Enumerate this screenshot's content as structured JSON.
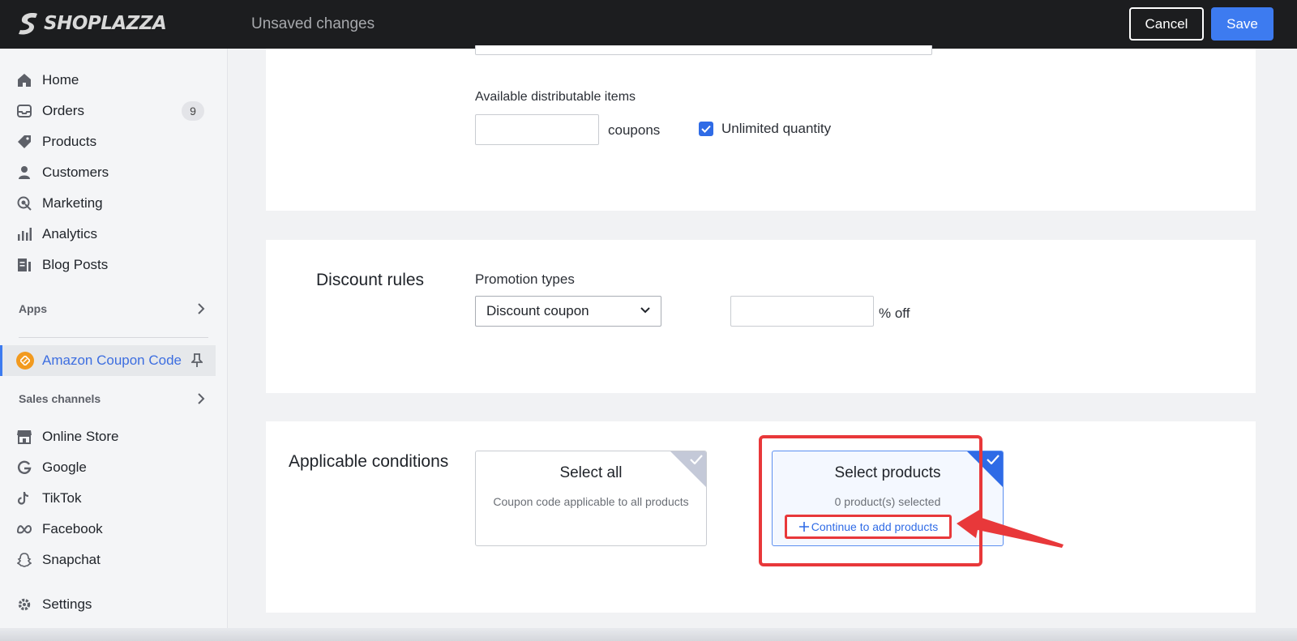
{
  "header": {
    "logo_text": "SHOPLAZZA",
    "status": "Unsaved changes",
    "cancel_label": "Cancel",
    "save_label": "Save"
  },
  "sidebar": {
    "items": [
      {
        "label": "Home",
        "icon": "home-icon"
      },
      {
        "label": "Orders",
        "icon": "inbox-icon",
        "badge": "9"
      },
      {
        "label": "Products",
        "icon": "tag-icon"
      },
      {
        "label": "Customers",
        "icon": "person-icon"
      },
      {
        "label": "Marketing",
        "icon": "target-icon"
      },
      {
        "label": "Analytics",
        "icon": "bar-chart-icon"
      },
      {
        "label": "Blog Posts",
        "icon": "document-icon"
      }
    ],
    "apps_label": "Apps",
    "active_app": "Amazon Coupon Code",
    "sales_channels_label": "Sales channels",
    "channels": [
      {
        "label": "Online Store",
        "icon": "store-icon"
      },
      {
        "label": "Google",
        "icon": "google-icon"
      },
      {
        "label": "TikTok",
        "icon": "tiktok-icon"
      },
      {
        "label": "Facebook",
        "icon": "meta-icon"
      },
      {
        "label": "Snapchat",
        "icon": "snapchat-icon"
      }
    ],
    "settings_label": "Settings"
  },
  "distribution": {
    "label": "Available distributable items",
    "quantity_value": "",
    "unit": "coupons",
    "unlimited_label": "Unlimited quantity",
    "unlimited_checked": true
  },
  "discount_rules": {
    "title": "Discount rules",
    "promotion_label": "Promotion types",
    "promotion_value": "Discount coupon",
    "percent_value": "",
    "percent_unit": "% off"
  },
  "conditions": {
    "title": "Applicable conditions",
    "select_all_title": "Select all",
    "select_all_sub": "Coupon code applicable to all products",
    "select_products_title": "Select products",
    "select_products_sub": "0 product(s) selected",
    "add_link": "Continue to add products"
  },
  "colors": {
    "accent": "#3d7bf0",
    "highlight": "#e8383a",
    "topbar": "#1c1d1f"
  }
}
